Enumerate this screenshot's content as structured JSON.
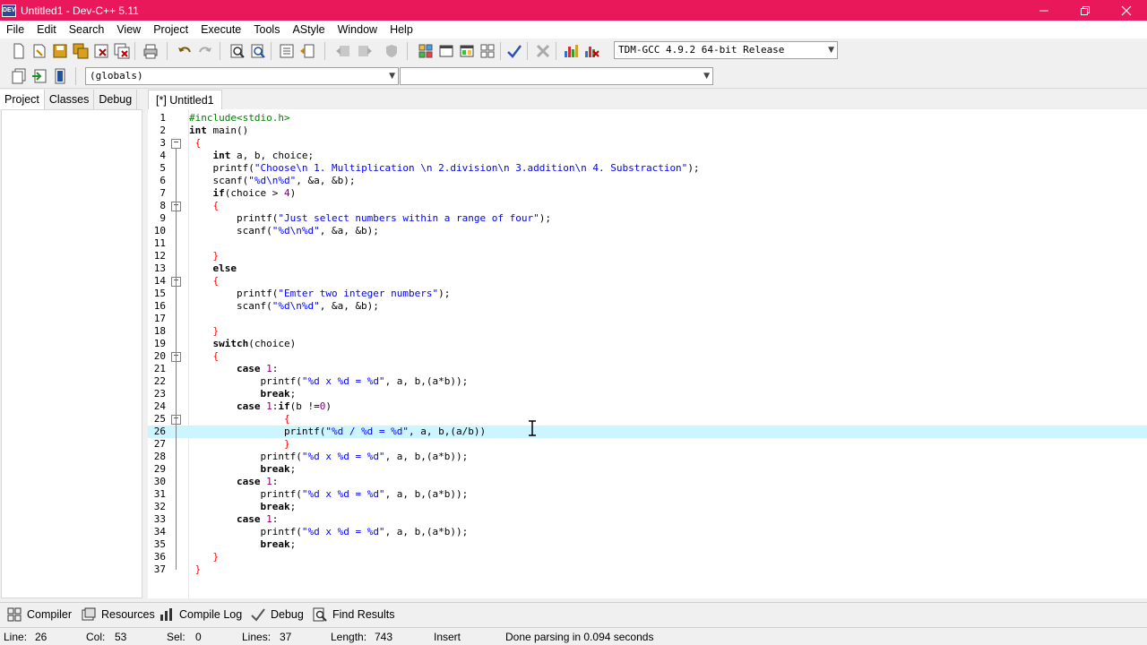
{
  "window": {
    "title": "Untitled1 - Dev-C++ 5.11",
    "app_icon_text": "DEV"
  },
  "menu": [
    "File",
    "Edit",
    "Search",
    "View",
    "Project",
    "Execute",
    "Tools",
    "AStyle",
    "Window",
    "Help"
  ],
  "toolbar": {
    "compiler": "TDM-GCC 4.9.2 64-bit Release",
    "scope": "(globals)",
    "symbol": ""
  },
  "left_panel": {
    "tabs": [
      "Project",
      "Classes",
      "Debug"
    ],
    "active": "Project"
  },
  "editor": {
    "tab": "[*] Untitled1",
    "current_line": 26,
    "lines": [
      "#include<stdio.h>",
      "int main()",
      " {",
      "    int a, b, choice;",
      "    printf(\"Choose\\n 1. Multiplication \\n 2.division\\n 3.addition\\n 4. Substraction\");",
      "    scanf(\"%d\\n%d\", &a, &b);",
      "    if(choice > 4)",
      "    {",
      "        printf(\"Just select numbers within a range of four\");",
      "        scanf(\"%d\\n%d\", &a, &b);",
      "",
      "    }",
      "    else",
      "    {",
      "        printf(\"Emter two integer numbers\");",
      "        scanf(\"%d\\n%d\", &a, &b);",
      "",
      "    }",
      "    switch(choice)",
      "    {",
      "        case 1:",
      "            printf(\"%d x %d = %d\", a, b,(a*b));",
      "            break;",
      "        case 1:if(b !=0)",
      "                {",
      "                printf(\"%d / %d = %d\", a, b,(a/b))",
      "                }",
      "            printf(\"%d x %d = %d\", a, b,(a*b));",
      "            break;",
      "        case 1:",
      "            printf(\"%d x %d = %d\", a, b,(a*b));",
      "            break;",
      "        case 1:",
      "            printf(\"%d x %d = %d\", a, b,(a*b));",
      "            break;",
      "    }",
      " }"
    ]
  },
  "bottom_tabs": [
    {
      "label": "Compiler",
      "icon": "grid-icon"
    },
    {
      "label": "Resources",
      "icon": "resources-icon"
    },
    {
      "label": "Compile Log",
      "icon": "chart-icon"
    },
    {
      "label": "Debug",
      "icon": "check-icon"
    },
    {
      "label": "Find Results",
      "icon": "find-icon"
    }
  ],
  "status": {
    "line_label": "Line:",
    "line": "26",
    "col_label": "Col:",
    "col": "53",
    "sel_label": "Sel:",
    "sel": "0",
    "lines_label": "Lines:",
    "lines": "37",
    "length_label": "Length:",
    "length": "743",
    "mode": "Insert",
    "message": "Done parsing in 0.094 seconds"
  },
  "colors": {
    "titlebar": "#e8185a",
    "current_line": "#ccf5ff",
    "string": "#0000ff",
    "number": "#800080",
    "preprocessor": "#008000"
  }
}
